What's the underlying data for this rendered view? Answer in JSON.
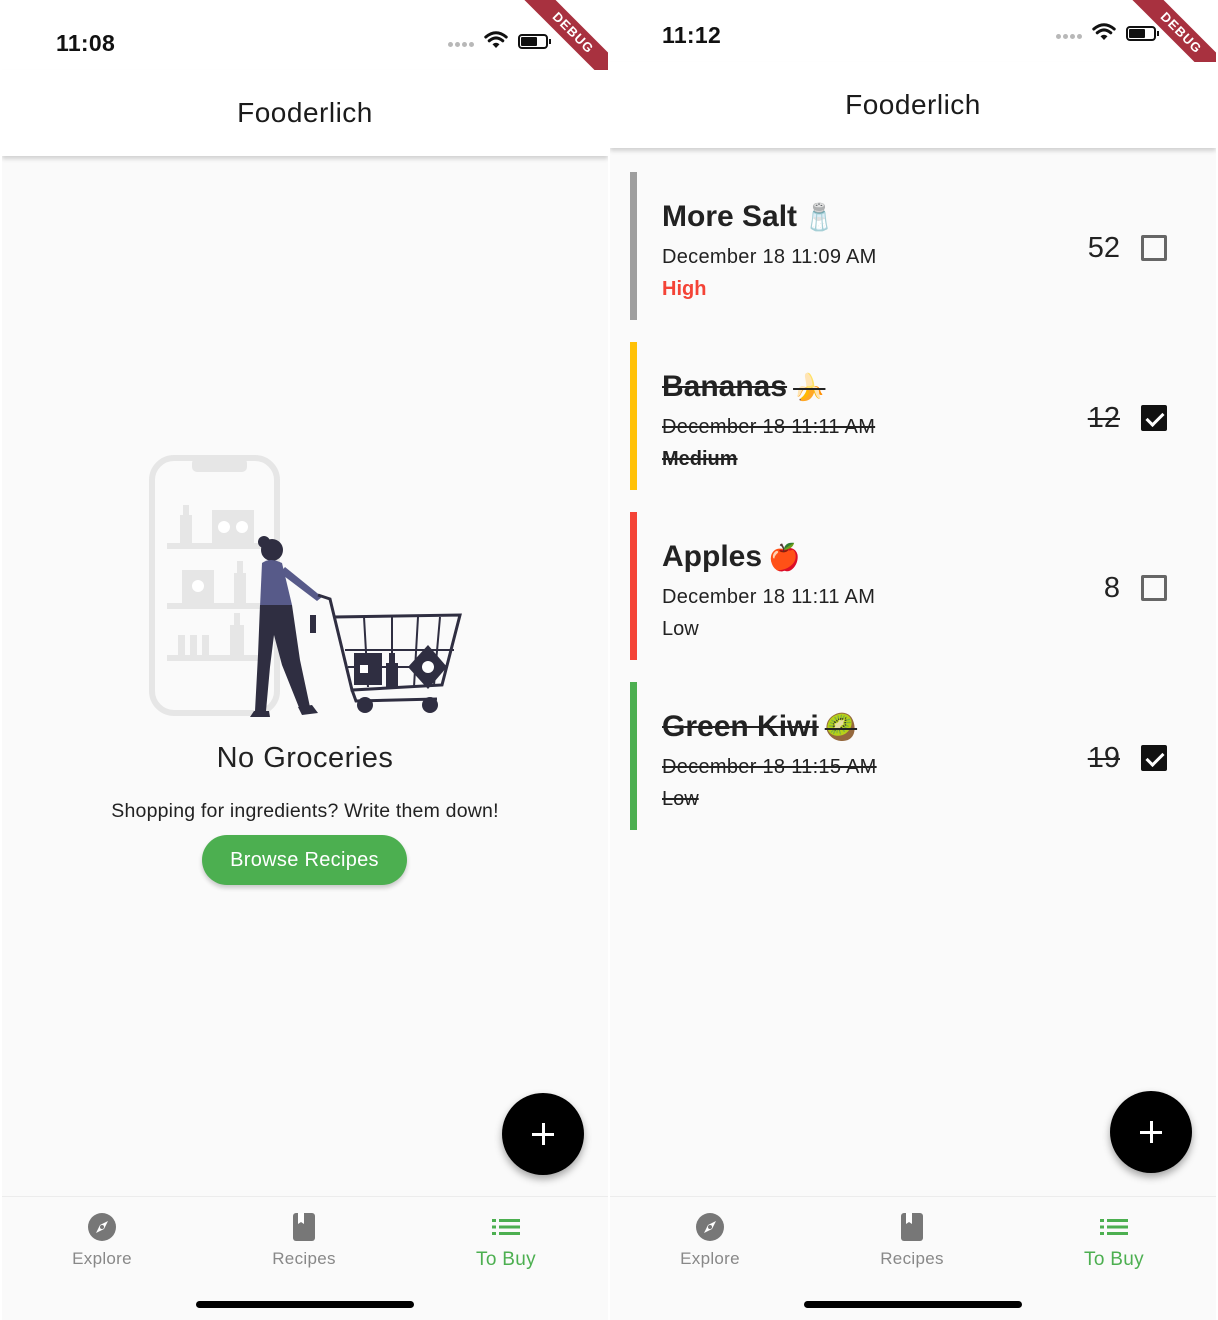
{
  "colors": {
    "accent_green": "#4caf50",
    "high_red": "#f44336",
    "medium_yellow": "#ffc107",
    "fab_black": "#000000"
  },
  "left_screen": {
    "status_time": "11:08",
    "debug_label": "DEBUG",
    "app_title": "Fooderlich",
    "empty_state": {
      "title": "No Groceries",
      "subtitle": "Shopping for ingredients? Write them down!",
      "button_label": "Browse Recipes"
    },
    "fab_icon": "plus-icon"
  },
  "right_screen": {
    "status_time": "11:12",
    "debug_label": "DEBUG",
    "app_title": "Fooderlich",
    "items": [
      {
        "name": "More Salt",
        "emoji": "🧂",
        "date": "December 18 11:09 AM",
        "importance": "High",
        "quantity": "52",
        "done": false,
        "color": "#9e9e9e"
      },
      {
        "name": "Bananas",
        "emoji": "🍌",
        "date": "December 18 11:11 AM",
        "importance": "Medium",
        "quantity": "12",
        "done": true,
        "color": "#ffc107"
      },
      {
        "name": "Apples",
        "emoji": "🍎",
        "date": "December 18 11:11 AM",
        "importance": "Low",
        "quantity": "8",
        "done": false,
        "color": "#f44336"
      },
      {
        "name": "Green Kiwi",
        "emoji": "🥝",
        "date": "December 18 11:15 AM",
        "importance": "Low",
        "quantity": "19",
        "done": true,
        "color": "#4caf50"
      }
    ],
    "fab_icon": "plus-icon"
  },
  "bottom_nav": {
    "items": [
      {
        "label": "Explore",
        "icon": "compass-icon",
        "active": false
      },
      {
        "label": "Recipes",
        "icon": "book-icon",
        "active": false
      },
      {
        "label": "To Buy",
        "icon": "list-icon",
        "active": true
      }
    ]
  }
}
